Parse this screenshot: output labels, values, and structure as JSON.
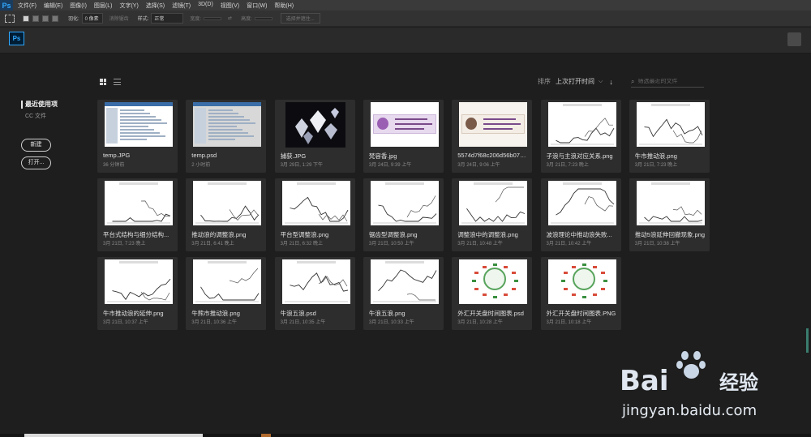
{
  "menubar": {
    "logo": "Ps",
    "items": [
      "文件(F)",
      "编辑(E)",
      "图像(I)",
      "图层(L)",
      "文字(Y)",
      "选择(S)",
      "滤镜(T)",
      "3D(D)",
      "视图(V)",
      "窗口(W)",
      "帮助(H)"
    ]
  },
  "options": {
    "feather_label": "羽化:",
    "feather_value": "0 像素",
    "antialias_label": "消除锯齿",
    "style_label": "样式:",
    "style_value": "正常",
    "width_label": "宽度:",
    "height_label": "高度:",
    "select_mask_label": "选择并遮住..."
  },
  "header": {
    "badge": "Ps"
  },
  "sidebar": {
    "recent_label": "最近使用项",
    "cc_label": "CC 文件",
    "new_button": "新建",
    "open_button": "打开..."
  },
  "sort": {
    "label": "排序",
    "value": "上次打开时间"
  },
  "search": {
    "placeholder": "筛选最近的文件"
  },
  "files": [
    {
      "name": "temp.JPG",
      "time": "36 分钟前",
      "thumb": "screen"
    },
    {
      "name": "temp.psd",
      "time": "2 小时前",
      "thumb": "screen-dark"
    },
    {
      "name": "捕获.JPG",
      "time": "3月 29日, 1:29 下午",
      "thumb": "diamond"
    },
    {
      "name": "梵容香.jpg",
      "time": "3月 24日, 9:39 上午",
      "thumb": "banner"
    },
    {
      "name": "5574d7f68c206d56b07ec5...",
      "time": "3月 24日, 9:06 上午",
      "thumb": "banner2"
    },
    {
      "name": "子浪与主浪对应关系.png",
      "time": "3月 21日, 7:23 晚上",
      "thumb": "chart"
    },
    {
      "name": "牛市推动浪.png",
      "time": "3月 21日, 7:23 晚上",
      "thumb": "chart"
    },
    {
      "name": "平台式结构与细分结构...",
      "time": "3月 21日, 7:23 晚上",
      "thumb": "chart"
    },
    {
      "name": "推动浪的调整浪.png",
      "time": "3月 21日, 6:41 晚上",
      "thumb": "chart"
    },
    {
      "name": "平台型调整浪.png",
      "time": "3月 21日, 6:32 晚上",
      "thumb": "chart"
    },
    {
      "name": "锯齿型调整浪.png",
      "time": "3月 21日, 10:50 上午",
      "thumb": "chart"
    },
    {
      "name": "调整浪中的调整浪.png",
      "time": "3月 21日, 10:48 上午",
      "thumb": "chart"
    },
    {
      "name": "波浪理论中推动浪失败...",
      "time": "3月 21日, 10:42 上午",
      "thumb": "chart"
    },
    {
      "name": "推动5浪延伸回撤现象.png",
      "time": "3月 21日, 10:38 上午",
      "thumb": "chart"
    },
    {
      "name": "牛市推动浪的延伸.png",
      "time": "3月 21日, 10:37 上午",
      "thumb": "chart"
    },
    {
      "name": "牛熊市推动浪.png",
      "time": "3月 21日, 10:36 上午",
      "thumb": "chart"
    },
    {
      "name": "牛浪五浪.psd",
      "time": "3月 21日, 10:35 上午",
      "thumb": "chart"
    },
    {
      "name": "牛浪五浪.png",
      "time": "3月 21日, 10:33 上午",
      "thumb": "chart"
    },
    {
      "name": "外汇开关盘时间图表.psd",
      "time": "3月 21日, 10:28 上午",
      "thumb": "wheel"
    },
    {
      "name": "外汇开关盘时间图表.PNG",
      "time": "3月 21日, 10:18 上午",
      "thumb": "wheel"
    }
  ],
  "watermark": {
    "brand": "Bai",
    "brand_cn": "经验",
    "url": "jingyan.baidu.com"
  }
}
